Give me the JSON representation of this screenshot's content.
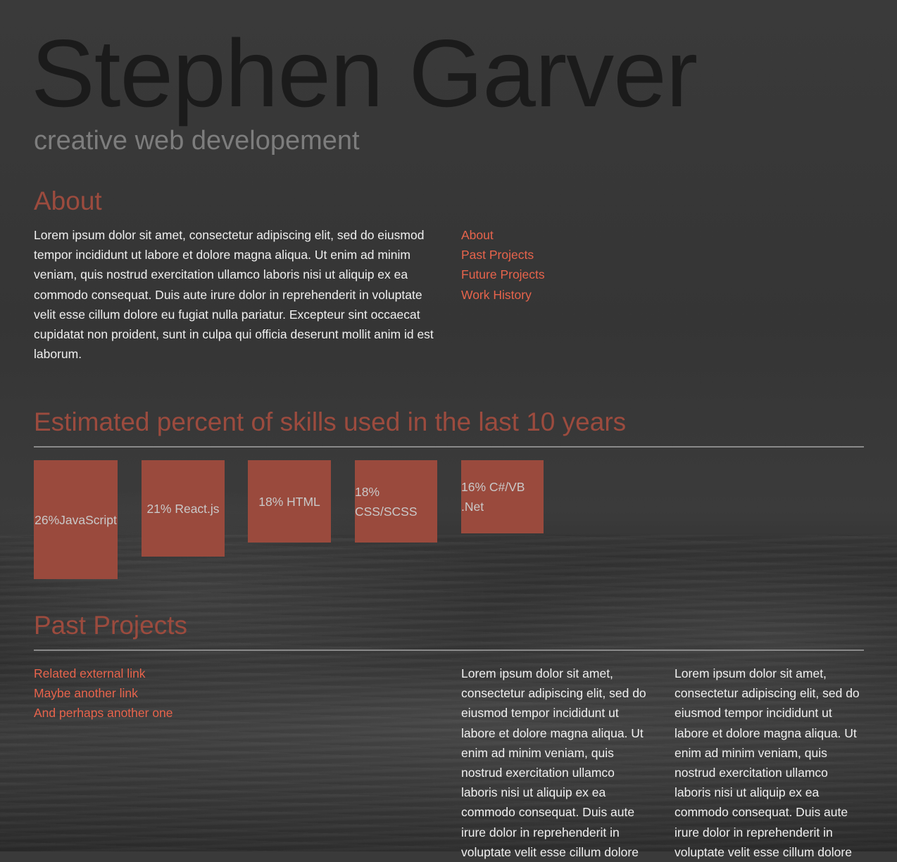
{
  "header": {
    "name": "Stephen Garver",
    "tagline": "creative web developement"
  },
  "about": {
    "title": "About",
    "text": "Lorem ipsum dolor sit amet, consectetur adipiscing elit, sed do eiusmod tempor incididunt ut labore et dolore magna aliqua. Ut enim ad minim veniam, quis nostrud exercitation ullamco laboris nisi ut aliquip ex ea commodo consequat. Duis aute irure dolor in reprehenderit in voluptate velit esse cillum dolore eu fugiat nulla pariatur. Excepteur sint occaecat cupidatat non proident, sunt in culpa qui officia deserunt mollit anim id est laborum."
  },
  "nav": {
    "items": [
      {
        "label": "About"
      },
      {
        "label": "Past Projects"
      },
      {
        "label": "Future Projects"
      },
      {
        "label": "Work History"
      }
    ]
  },
  "skills": {
    "title": "Estimated percent of skills used in the last 10 years",
    "items": [
      {
        "label": "26%JavaScript",
        "percent": 26
      },
      {
        "label": "21% React.js",
        "percent": 21
      },
      {
        "label": "18% HTML",
        "percent": 18
      },
      {
        "label": "18% CSS/SCSS",
        "percent": 18
      },
      {
        "label": "16% C#/VB .Net",
        "percent": 16
      }
    ]
  },
  "projects": {
    "title": "Past Projects",
    "links": [
      {
        "label": "Related external link"
      },
      {
        "label": "Maybe another link"
      },
      {
        "label": "And perhaps another one"
      }
    ],
    "column1": "Lorem ipsum dolor sit amet, consectetur adipiscing elit, sed do eiusmod tempor incididunt ut labore et dolore magna aliqua. Ut enim ad minim veniam, quis nostrud exercitation ullamco laboris nisi ut aliquip ex ea commodo consequat. Duis aute irure dolor in reprehenderit in voluptate velit esse cillum dolore",
    "column2": "Lorem ipsum dolor sit amet, consectetur adipiscing elit, sed do eiusmod tempor incididunt ut labore et dolore magna aliqua. Ut enim ad minim veniam, quis nostrud exercitation ullamco laboris nisi ut aliquip ex ea commodo consequat. Duis aute irure dolor in reprehenderit in voluptate velit esse cillum dolore"
  },
  "colors": {
    "accent_link": "#e8644c",
    "heading": "#9c4b3e",
    "skill_block": "#9a4a3d"
  }
}
